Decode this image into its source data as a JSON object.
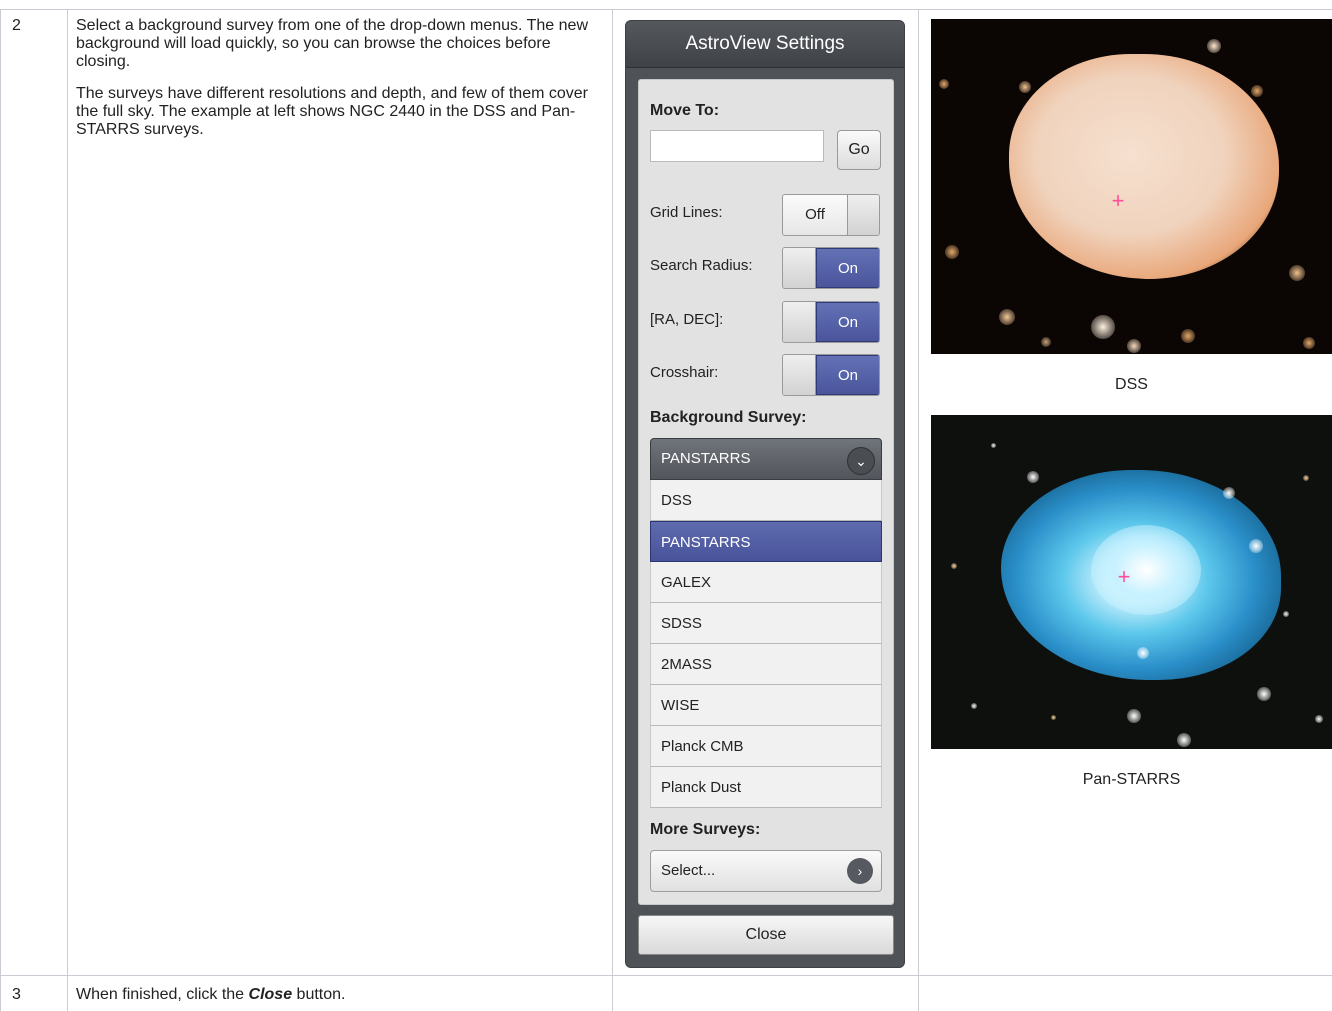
{
  "row2": {
    "step": "2",
    "para1": "Select a background survey from one of the drop-down menus. The new background will load quickly, so you can browse the choices before closing.",
    "para2": "The surveys have different resolutions and depth, and few of them cover the full sky. The example at left shows NGC 2440 in the DSS and Pan-STARRS surveys."
  },
  "row3": {
    "step": "3",
    "text_before": "When finished, click the ",
    "text_bold": "Close",
    "text_after": " button."
  },
  "settings": {
    "title": "AstroView Settings",
    "move_to_label": "Move To:",
    "move_to_value": "",
    "go_label": "Go",
    "grid_lines_label": "Grid Lines:",
    "grid_lines_state": "Off",
    "search_radius_label": "Search Radius:",
    "search_radius_state": "On",
    "radec_label": "[RA, DEC]:",
    "radec_state": "On",
    "crosshair_label": "Crosshair:",
    "crosshair_state": "On",
    "background_survey_label": "Background Survey:",
    "background_survey_selected": "PANSTARRS",
    "survey_options": [
      "DSS",
      "PANSTARRS",
      "GALEX",
      "SDSS",
      "2MASS",
      "WISE",
      "Planck CMB",
      "Planck Dust"
    ],
    "more_surveys_label": "More Surveys:",
    "select_label": "Select...",
    "close_label": "Close",
    "accent_color": "#4f5aa0",
    "panel_color": "#4f5257"
  },
  "images": {
    "dss_caption": "DSS",
    "panstarrs_caption": "Pan-STARRS"
  }
}
